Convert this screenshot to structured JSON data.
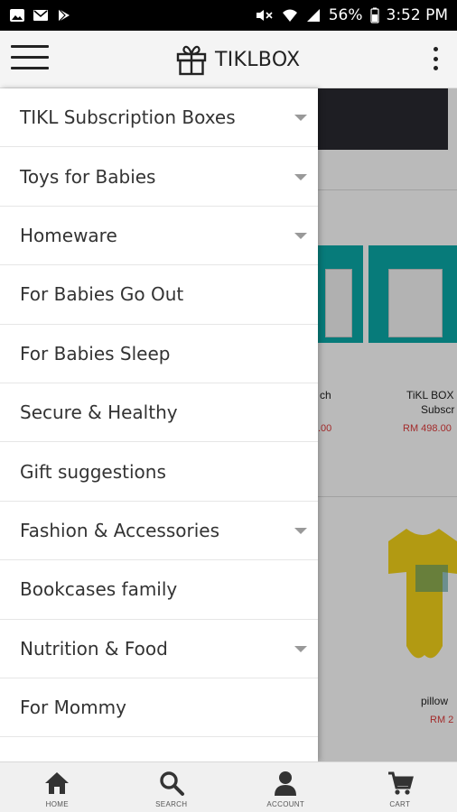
{
  "status_bar": {
    "battery": "56%",
    "time": "3:52 PM"
  },
  "app_bar": {
    "title": "TIKLBOX"
  },
  "background": {
    "product_1_name": "TiKL BOX",
    "product_1_sub": "Subscr",
    "product_1_price": "RM 498.00",
    "product_0_name": "ch",
    "product_0_price": ".00",
    "product_2_name": "pillow",
    "product_2_price": "RM 2"
  },
  "drawer": {
    "items": [
      {
        "label": "TIKL Subscription Boxes",
        "expandable": true
      },
      {
        "label": "Toys for Babies",
        "expandable": true
      },
      {
        "label": "Homeware",
        "expandable": true
      },
      {
        "label": "For Babies Go Out",
        "expandable": false
      },
      {
        "label": "For Babies Sleep",
        "expandable": false
      },
      {
        "label": "Secure & Healthy",
        "expandable": false
      },
      {
        "label": "Gift suggestions",
        "expandable": false
      },
      {
        "label": "Fashion & Accessories",
        "expandable": true
      },
      {
        "label": "Bookcases family",
        "expandable": false
      },
      {
        "label": "Nutrition & Food",
        "expandable": true
      },
      {
        "label": "For Mommy",
        "expandable": false
      }
    ]
  },
  "bottom_nav": {
    "home": "HOME",
    "search": "SEARCH",
    "account": "ACCOUNT",
    "cart": "CART"
  },
  "colors": {
    "accent_teal": "#0aa9a8",
    "price_red": "#e03a3a",
    "onesie_yellow": "#f5d41a"
  }
}
